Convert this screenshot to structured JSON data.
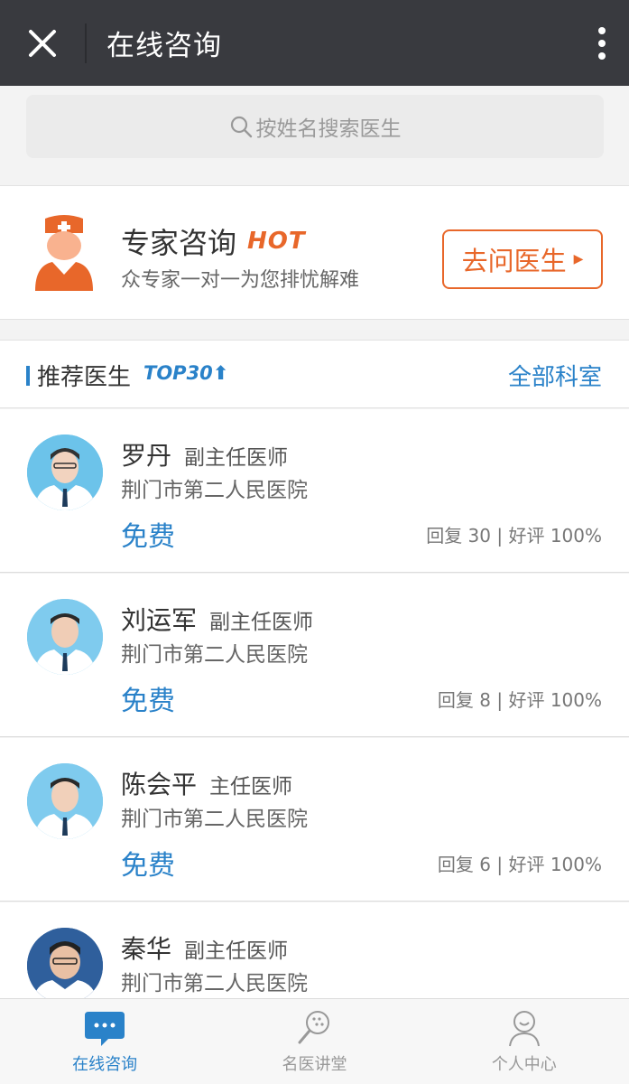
{
  "header": {
    "title": "在线咨询"
  },
  "search": {
    "placeholder": "按姓名搜索医生"
  },
  "expert": {
    "title": "专家咨询",
    "badge": "HOT",
    "subtitle": "众专家一对一为您排忧解难",
    "button": "去问医生"
  },
  "recommend": {
    "title": "推荐医生",
    "badge": "TOP30",
    "link": "全部科室"
  },
  "doctors": [
    {
      "name": "罗丹",
      "rank": "副主任医师",
      "hospital": "荆门市第二人民医院",
      "price": "免费",
      "stats": "回复 30 | 好评 100%"
    },
    {
      "name": "刘运军",
      "rank": "副主任医师",
      "hospital": "荆门市第二人民医院",
      "price": "免费",
      "stats": "回复 8 | 好评 100%"
    },
    {
      "name": "陈会平",
      "rank": "主任医师",
      "hospital": "荆门市第二人民医院",
      "price": "免费",
      "stats": "回复 6 | 好评 100%"
    },
    {
      "name": "秦华",
      "rank": "副主任医师",
      "hospital": "荆门市第二人民医院",
      "price": "",
      "stats": ""
    }
  ],
  "tabs": [
    {
      "label": "在线咨询",
      "icon": "chat-bubble-icon",
      "active": true
    },
    {
      "label": "名医讲堂",
      "icon": "lecture-icon",
      "active": false
    },
    {
      "label": "个人中心",
      "icon": "person-icon",
      "active": false
    }
  ],
  "colors": {
    "accent": "#2a82c9",
    "orange": "#e8672a",
    "topbar": "#393a3f"
  }
}
